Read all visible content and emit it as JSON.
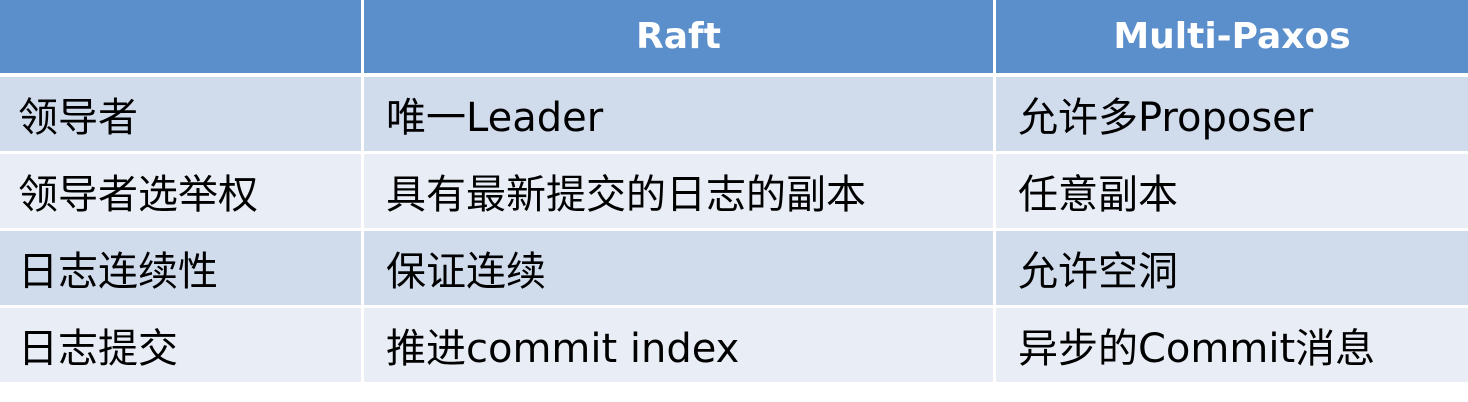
{
  "table": {
    "headers": [
      "",
      "Raft",
      "Multi-Paxos"
    ],
    "rows": [
      [
        "领导者",
        "唯一Leader",
        "允许多Proposer"
      ],
      [
        "领导者选举权",
        "具有最新提交的日志的副本",
        "任意副本"
      ],
      [
        "日志连续性",
        "保证连续",
        "允许空洞"
      ],
      [
        "日志提交",
        "推进commit index",
        "异步的Commit消息"
      ]
    ]
  },
  "colors": {
    "header_bg": "#5b8fcc",
    "header_text": "#ffffff",
    "row_odd_bg": "#d0dbec",
    "row_even_bg": "#e9eef6",
    "cell_text": "#000000"
  }
}
